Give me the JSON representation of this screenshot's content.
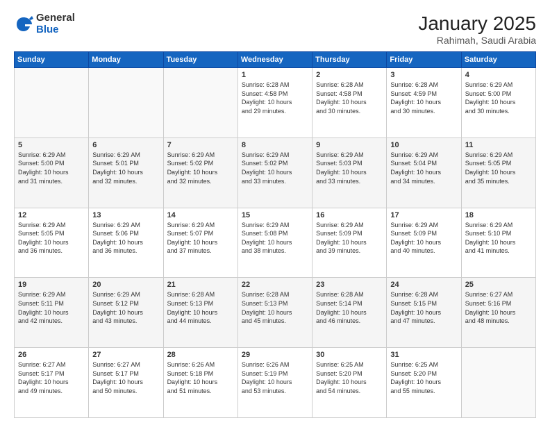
{
  "header": {
    "logo_general": "General",
    "logo_blue": "Blue",
    "month_year": "January 2025",
    "location": "Rahimah, Saudi Arabia"
  },
  "weekdays": [
    "Sunday",
    "Monday",
    "Tuesday",
    "Wednesday",
    "Thursday",
    "Friday",
    "Saturday"
  ],
  "weeks": [
    [
      {
        "day": "",
        "text": ""
      },
      {
        "day": "",
        "text": ""
      },
      {
        "day": "",
        "text": ""
      },
      {
        "day": "1",
        "text": "Sunrise: 6:28 AM\nSunset: 4:58 PM\nDaylight: 10 hours\nand 29 minutes."
      },
      {
        "day": "2",
        "text": "Sunrise: 6:28 AM\nSunset: 4:58 PM\nDaylight: 10 hours\nand 30 minutes."
      },
      {
        "day": "3",
        "text": "Sunrise: 6:28 AM\nSunset: 4:59 PM\nDaylight: 10 hours\nand 30 minutes."
      },
      {
        "day": "4",
        "text": "Sunrise: 6:29 AM\nSunset: 5:00 PM\nDaylight: 10 hours\nand 30 minutes."
      }
    ],
    [
      {
        "day": "5",
        "text": "Sunrise: 6:29 AM\nSunset: 5:00 PM\nDaylight: 10 hours\nand 31 minutes."
      },
      {
        "day": "6",
        "text": "Sunrise: 6:29 AM\nSunset: 5:01 PM\nDaylight: 10 hours\nand 32 minutes."
      },
      {
        "day": "7",
        "text": "Sunrise: 6:29 AM\nSunset: 5:02 PM\nDaylight: 10 hours\nand 32 minutes."
      },
      {
        "day": "8",
        "text": "Sunrise: 6:29 AM\nSunset: 5:02 PM\nDaylight: 10 hours\nand 33 minutes."
      },
      {
        "day": "9",
        "text": "Sunrise: 6:29 AM\nSunset: 5:03 PM\nDaylight: 10 hours\nand 33 minutes."
      },
      {
        "day": "10",
        "text": "Sunrise: 6:29 AM\nSunset: 5:04 PM\nDaylight: 10 hours\nand 34 minutes."
      },
      {
        "day": "11",
        "text": "Sunrise: 6:29 AM\nSunset: 5:05 PM\nDaylight: 10 hours\nand 35 minutes."
      }
    ],
    [
      {
        "day": "12",
        "text": "Sunrise: 6:29 AM\nSunset: 5:05 PM\nDaylight: 10 hours\nand 36 minutes."
      },
      {
        "day": "13",
        "text": "Sunrise: 6:29 AM\nSunset: 5:06 PM\nDaylight: 10 hours\nand 36 minutes."
      },
      {
        "day": "14",
        "text": "Sunrise: 6:29 AM\nSunset: 5:07 PM\nDaylight: 10 hours\nand 37 minutes."
      },
      {
        "day": "15",
        "text": "Sunrise: 6:29 AM\nSunset: 5:08 PM\nDaylight: 10 hours\nand 38 minutes."
      },
      {
        "day": "16",
        "text": "Sunrise: 6:29 AM\nSunset: 5:09 PM\nDaylight: 10 hours\nand 39 minutes."
      },
      {
        "day": "17",
        "text": "Sunrise: 6:29 AM\nSunset: 5:09 PM\nDaylight: 10 hours\nand 40 minutes."
      },
      {
        "day": "18",
        "text": "Sunrise: 6:29 AM\nSunset: 5:10 PM\nDaylight: 10 hours\nand 41 minutes."
      }
    ],
    [
      {
        "day": "19",
        "text": "Sunrise: 6:29 AM\nSunset: 5:11 PM\nDaylight: 10 hours\nand 42 minutes."
      },
      {
        "day": "20",
        "text": "Sunrise: 6:29 AM\nSunset: 5:12 PM\nDaylight: 10 hours\nand 43 minutes."
      },
      {
        "day": "21",
        "text": "Sunrise: 6:28 AM\nSunset: 5:13 PM\nDaylight: 10 hours\nand 44 minutes."
      },
      {
        "day": "22",
        "text": "Sunrise: 6:28 AM\nSunset: 5:13 PM\nDaylight: 10 hours\nand 45 minutes."
      },
      {
        "day": "23",
        "text": "Sunrise: 6:28 AM\nSunset: 5:14 PM\nDaylight: 10 hours\nand 46 minutes."
      },
      {
        "day": "24",
        "text": "Sunrise: 6:28 AM\nSunset: 5:15 PM\nDaylight: 10 hours\nand 47 minutes."
      },
      {
        "day": "25",
        "text": "Sunrise: 6:27 AM\nSunset: 5:16 PM\nDaylight: 10 hours\nand 48 minutes."
      }
    ],
    [
      {
        "day": "26",
        "text": "Sunrise: 6:27 AM\nSunset: 5:17 PM\nDaylight: 10 hours\nand 49 minutes."
      },
      {
        "day": "27",
        "text": "Sunrise: 6:27 AM\nSunset: 5:17 PM\nDaylight: 10 hours\nand 50 minutes."
      },
      {
        "day": "28",
        "text": "Sunrise: 6:26 AM\nSunset: 5:18 PM\nDaylight: 10 hours\nand 51 minutes."
      },
      {
        "day": "29",
        "text": "Sunrise: 6:26 AM\nSunset: 5:19 PM\nDaylight: 10 hours\nand 53 minutes."
      },
      {
        "day": "30",
        "text": "Sunrise: 6:25 AM\nSunset: 5:20 PM\nDaylight: 10 hours\nand 54 minutes."
      },
      {
        "day": "31",
        "text": "Sunrise: 6:25 AM\nSunset: 5:20 PM\nDaylight: 10 hours\nand 55 minutes."
      },
      {
        "day": "",
        "text": ""
      }
    ]
  ]
}
